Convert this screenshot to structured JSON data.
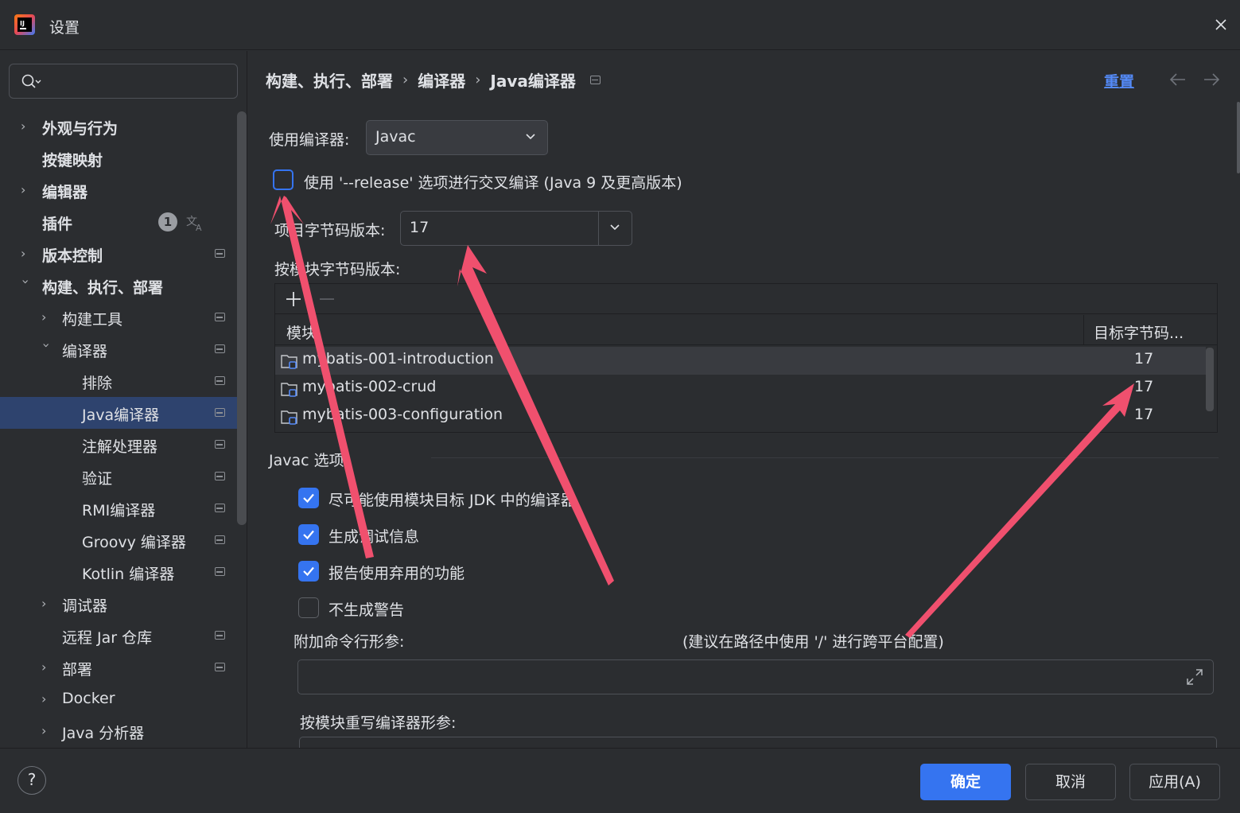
{
  "window": {
    "title": "设置"
  },
  "sidebar": {
    "search_placeholder": "",
    "items": [
      {
        "label": "外观与行为"
      },
      {
        "label": "按键映射"
      },
      {
        "label": "编辑器"
      },
      {
        "label": "插件",
        "badge": "1"
      },
      {
        "label": "版本控制"
      },
      {
        "label": "构建、执行、部署"
      },
      {
        "label": "构建工具"
      },
      {
        "label": "编译器"
      },
      {
        "label": "排除"
      },
      {
        "label": "Java编译器"
      },
      {
        "label": "注解处理器"
      },
      {
        "label": "验证"
      },
      {
        "label": "RMI编译器"
      },
      {
        "label": "Groovy 编译器"
      },
      {
        "label": "Kotlin 编译器"
      },
      {
        "label": "调试器"
      },
      {
        "label": "远程 Jar 仓库"
      },
      {
        "label": "部署"
      },
      {
        "label": "Docker"
      },
      {
        "label": "Java 分析器"
      }
    ]
  },
  "header": {
    "breadcrumb": [
      "构建、执行、部署",
      "编译器",
      "Java编译器"
    ],
    "reset_label": "重置"
  },
  "form": {
    "compiler_label": "使用编译器:",
    "compiler_value": "Javac",
    "release_option_label": "使用 '--release' 选项进行交叉编译 (Java 9 及更高版本)",
    "release_option_checked": false,
    "bytecode_label": "项目字节码版本:",
    "bytecode_value": "17",
    "per_module_label": "按模块字节码版本:",
    "table": {
      "columns": [
        "模块",
        "目标字节码..."
      ],
      "rows": [
        {
          "name": "mybatis-001-introduction",
          "target": "17"
        },
        {
          "name": "mybatis-002-crud",
          "target": "17"
        },
        {
          "name": "mybatis-003-configuration",
          "target": "17"
        }
      ]
    },
    "javac_section_title": "Javac 选项",
    "javac_options": [
      {
        "label": "尽可能使用模块目标 JDK 中的编译器",
        "checked": true
      },
      {
        "label": "生成调试信息",
        "checked": true
      },
      {
        "label": "报告使用弃用的功能",
        "checked": true
      },
      {
        "label": "不生成警告",
        "checked": false
      }
    ],
    "extra_args_label": "附加命令行形参:",
    "extra_args_hint": "(建议在路径中使用 '/' 进行跨平台配置)",
    "extra_args_value": "",
    "override_label": "按模块重写编译器形参:"
  },
  "footer": {
    "help_label": "?",
    "ok_label": "确定",
    "cancel_label": "取消",
    "apply_label": "应用(A)"
  },
  "colors": {
    "accent": "#3574f0",
    "link": "#548af7",
    "selection": "#2e436e",
    "annotation_arrow": "#f0506e"
  }
}
